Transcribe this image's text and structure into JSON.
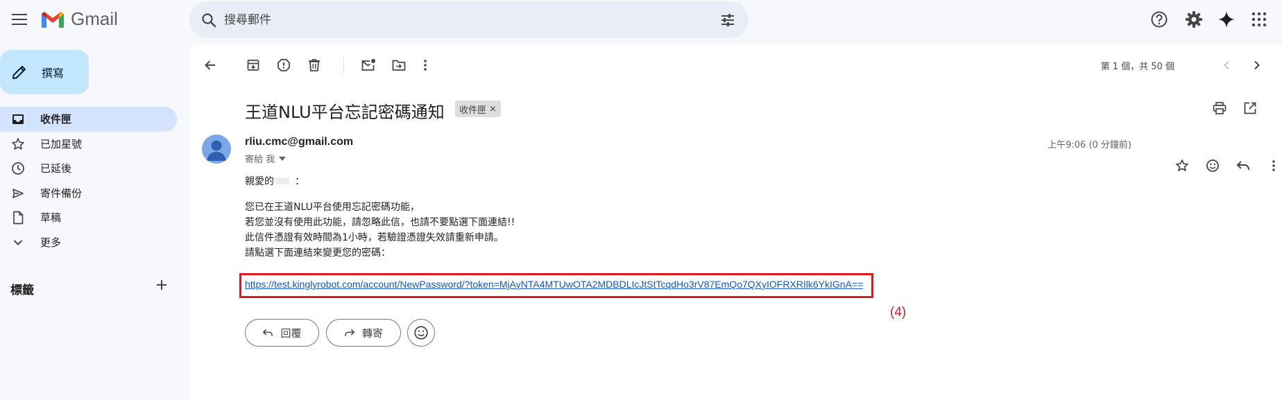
{
  "app": {
    "name": "Gmail"
  },
  "search": {
    "placeholder": "搜尋郵件"
  },
  "compose": {
    "label": "撰寫"
  },
  "sidebar": {
    "items": [
      {
        "label": "收件匣",
        "icon": "inbox-icon",
        "active": true
      },
      {
        "label": "已加星號",
        "icon": "star-icon"
      },
      {
        "label": "已延後",
        "icon": "clock-icon"
      },
      {
        "label": "寄件備份",
        "icon": "send-icon"
      },
      {
        "label": "草稿",
        "icon": "draft-icon"
      },
      {
        "label": "更多",
        "icon": "chevron-down-icon"
      }
    ],
    "labels_heading": "標籤"
  },
  "toolbar": {
    "pager": "第 1 個，共 50 個"
  },
  "email": {
    "subject": "王道NLU平台忘記密碼通知",
    "label_chip": "收件匣",
    "sender": "rliu.cmc@gmail.com",
    "to": "寄給 我",
    "time": "上午9:06 (0 分鐘前)",
    "greeting_prefix": "親愛的",
    "greeting_suffix": "：",
    "lines": [
      "您已在王道NLU平台使用忘記密碼功能，",
      "若您並沒有使用此功能，請忽略此信，也請不要點選下面連結!!",
      "此信件憑證有效時間為1小時，若驗證憑證失效請重新申請。",
      "請點選下面連結來變更您的密碼："
    ],
    "link": "https://test.kinglyrobot.com/account/NewPassword/?token=MjAyNTA4MTUwOTA2MDBDLIcJtStTcqdHo3rV87EmQo7QXyIOFRXRIlk6YkIGnA==",
    "annotation": "(4)",
    "reply_label": "回覆",
    "forward_label": "轉寄"
  },
  "colors": {
    "accent": "#0b57d0",
    "highlight_box": "#e0191c",
    "compose_bg": "#c2e7ff",
    "nav_active": "#d3e3fd"
  }
}
